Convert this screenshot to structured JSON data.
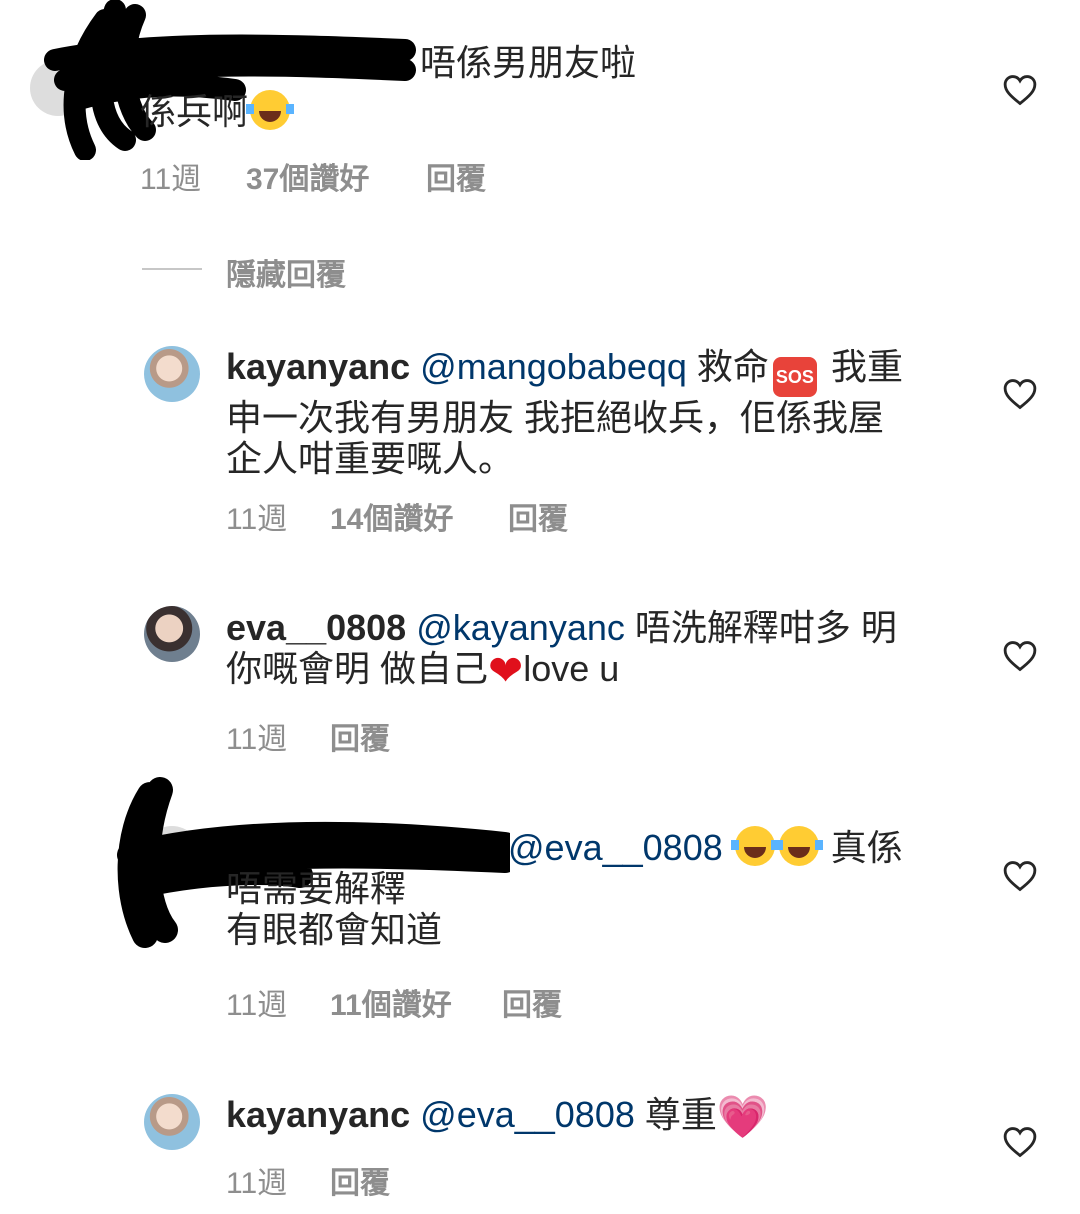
{
  "comments": [
    {
      "text": "唔係男朋友啦",
      "text_line2": "係兵啊",
      "time": "11週",
      "likes": "37個讚好",
      "reply": "回覆"
    },
    {
      "hide_replies": "隱藏回覆"
    },
    {
      "username": "kayanyanc",
      "mention": "@mangobabeqq",
      "text_a": "救命",
      "sos": "SOS",
      "text_b": "我重",
      "line2": "申一次我有男朋友 我拒絕收兵，佢係我屋",
      "line3": "企人咁重要嘅人。",
      "time": "11週",
      "likes": "14個讚好",
      "reply": "回覆"
    },
    {
      "username": "eva__0808",
      "mention": "@kayanyanc",
      "line1_text": "唔洗解釋咁多 明",
      "line2_a": "你嘅會明  做自己",
      "line2_b": "love u",
      "time": "11週",
      "reply": "回覆"
    },
    {
      "mention": "@eva__0808",
      "line1_text": "真係",
      "line2": "唔需要解釋",
      "line3": "有眼都會知道",
      "time": "11週",
      "likes": "11個讚好",
      "reply": "回覆"
    },
    {
      "username": "kayanyanc",
      "mention": "@eva__0808",
      "text": "尊重",
      "time": "11週",
      "reply": "回覆"
    }
  ],
  "icons": {
    "like": "heart-outline-icon",
    "laugh": "tears-of-joy-emoji",
    "red_heart": "red-heart-emoji",
    "pink_heart": "sparkling-heart-emoji"
  },
  "colors": {
    "text": "#262626",
    "meta": "#8e8e8e",
    "mention": "#00376b",
    "heart_outline": "#262626"
  }
}
